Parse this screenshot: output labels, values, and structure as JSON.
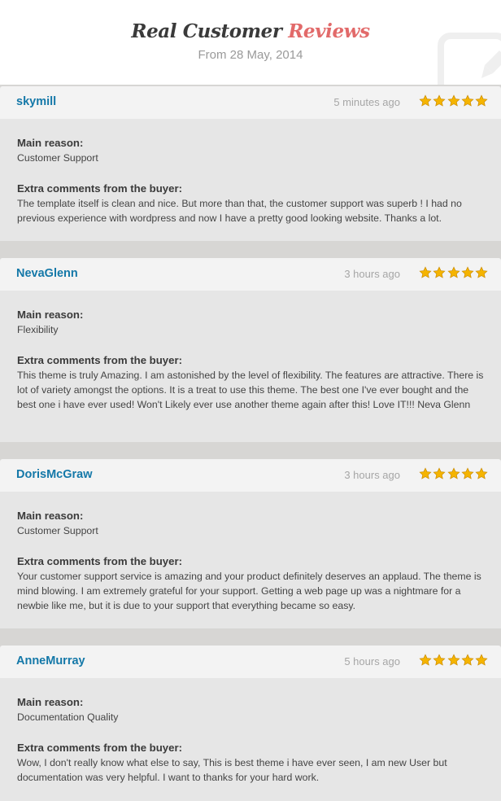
{
  "header": {
    "title_main": "Real Customer ",
    "title_accent": "Reviews",
    "subtitle": "From 28 May, 2014",
    "decor_icon": "pen-on-paper-icon"
  },
  "colors": {
    "accent": "#e26a6a",
    "username": "#1478a8",
    "star": "#f5b400"
  },
  "labels": {
    "main_reason": "Main reason:",
    "extra_comments": "Extra comments from the buyer:"
  },
  "reviews": [
    {
      "username": "skymill",
      "time": "5 minutes ago",
      "rating": 5,
      "main_reason": "Customer Support",
      "comment": "The template itself is clean and nice. But more than that, the customer support was superb ! I had no previous experience with wordpress and now I have a pretty good looking website. Thanks a lot."
    },
    {
      "username": "NevaGlenn",
      "time": "3 hours ago",
      "rating": 5,
      "main_reason": "Flexibility",
      "comment": "This theme is truly Amazing. I am astonished by the level of flexibility. The features are attractive. There is lot of variety amongst the options. It is a treat to use this theme. The best one I've ever bought and the best one i have ever used! Won't Likely ever use another theme again after this! Love IT!!! Neva Glenn"
    },
    {
      "username": "DorisMcGraw",
      "time": "3 hours ago",
      "rating": 5,
      "main_reason": "Customer Support",
      "comment": "Your customer support service is amazing and your product definitely deserves an applaud. The theme is mind blowing. I am extremely grateful for your support. Getting a web page up was a nightmare for a newbie like me, but it is due to your support that everything became so easy."
    },
    {
      "username": "AnneMurray",
      "time": "5 hours ago",
      "rating": 5,
      "main_reason": "Documentation Quality",
      "comment": "Wow, I don't really know what else to say, This is best theme i have ever seen, I am new User but documentation was very helpful. I want to thanks for your hard work."
    }
  ]
}
